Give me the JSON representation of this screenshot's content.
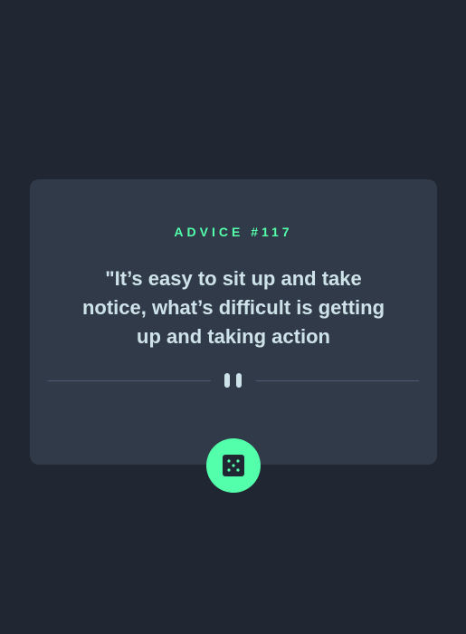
{
  "advice": {
    "id_label": "ADVICE #117",
    "quote": "\"It’s easy to sit up and take notice, what’s difficult is getting up and taking action"
  },
  "colors": {
    "background": "#202733",
    "card": "#313a48",
    "accent": "#53ffaa",
    "text": "#cee3e9",
    "divider": "#4f5d74"
  },
  "icons": {
    "divider": "pause-icon",
    "button": "dice-icon"
  }
}
